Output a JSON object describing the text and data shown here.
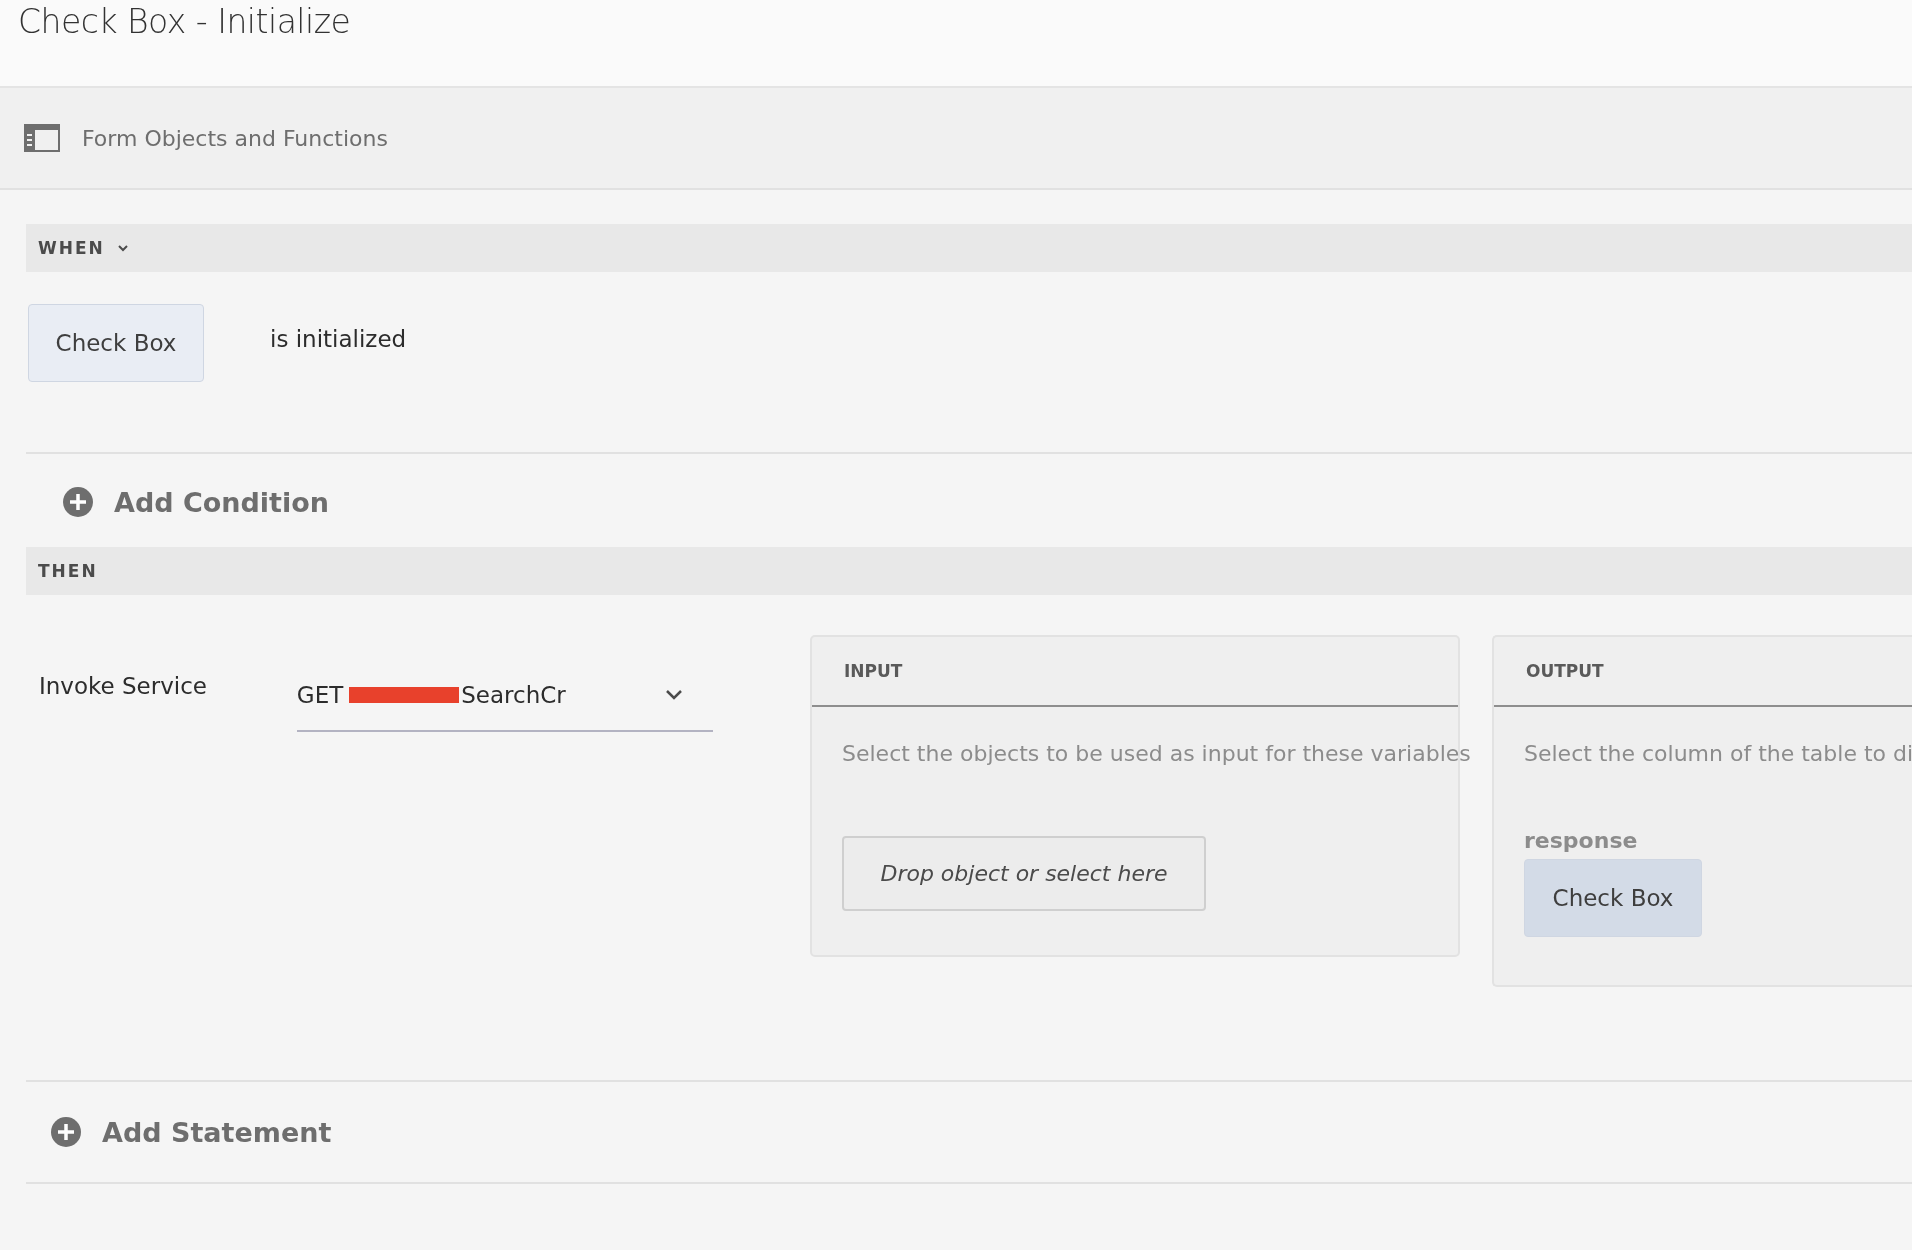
{
  "window": {
    "title": "Check Box - Initialize"
  },
  "panel_toggle": {
    "label": "Form Objects and Functions"
  },
  "when": {
    "label": "WHEN",
    "expanded": true,
    "object": "Check Box",
    "event": "is initialized"
  },
  "add_condition": {
    "label": "Add Condition"
  },
  "then": {
    "label": "THEN"
  },
  "statement": {
    "action": "Invoke Service",
    "service": {
      "value_start": "GET",
      "value_end": "SearchCr",
      "redacted": true
    },
    "input": {
      "heading": "INPUT",
      "hint": "Select the objects to be used as input for these variables",
      "placeholder": "Drop object or select here"
    },
    "output": {
      "heading": "OUTPUT",
      "hint": "Select the column of the table to di",
      "field": "response",
      "object": "Check Box"
    }
  },
  "add_statement": {
    "label": "Add Statement"
  }
}
